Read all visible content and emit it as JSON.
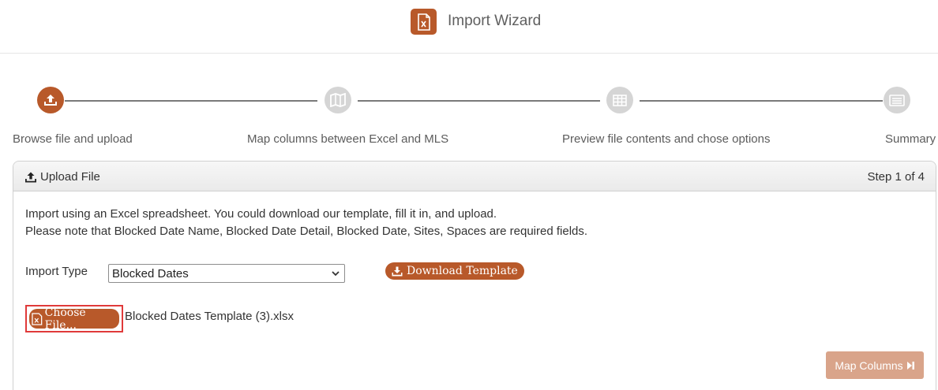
{
  "header": {
    "logo_icon": "excel-file-icon",
    "title": "Import Wizard"
  },
  "steps": [
    {
      "label": "Browse file and upload",
      "icon": "upload-icon",
      "active": true
    },
    {
      "label": "Map columns between Excel and MLS",
      "icon": "map-icon",
      "active": false
    },
    {
      "label": "Preview file contents and chose options",
      "icon": "table-icon",
      "active": false
    },
    {
      "label": "Summary",
      "icon": "list-icon",
      "active": false
    }
  ],
  "panel": {
    "title": "Upload File",
    "title_icon": "upload-icon",
    "step_indicator": "Step 1 of 4",
    "intro_line1": "Import using an Excel spreadsheet. You could download our template, fill it in, and upload.",
    "intro_line2": "Please note that Blocked Date Name, Blocked Date Detail, Blocked Date, Sites, Spaces are required fields.",
    "import_type_label": "Import Type",
    "import_type_value": "Blocked Dates",
    "download_template_label": "Download Template",
    "choose_file_label": "Choose File...",
    "file_name": "Blocked Dates Template (3).xlsx",
    "map_columns_label": "Map Columns"
  },
  "colors": {
    "accent": "#b8592a",
    "inactive_step": "#d5d5d5",
    "disabled_button": "#d9a48a",
    "highlight_border": "#e03a3a"
  }
}
